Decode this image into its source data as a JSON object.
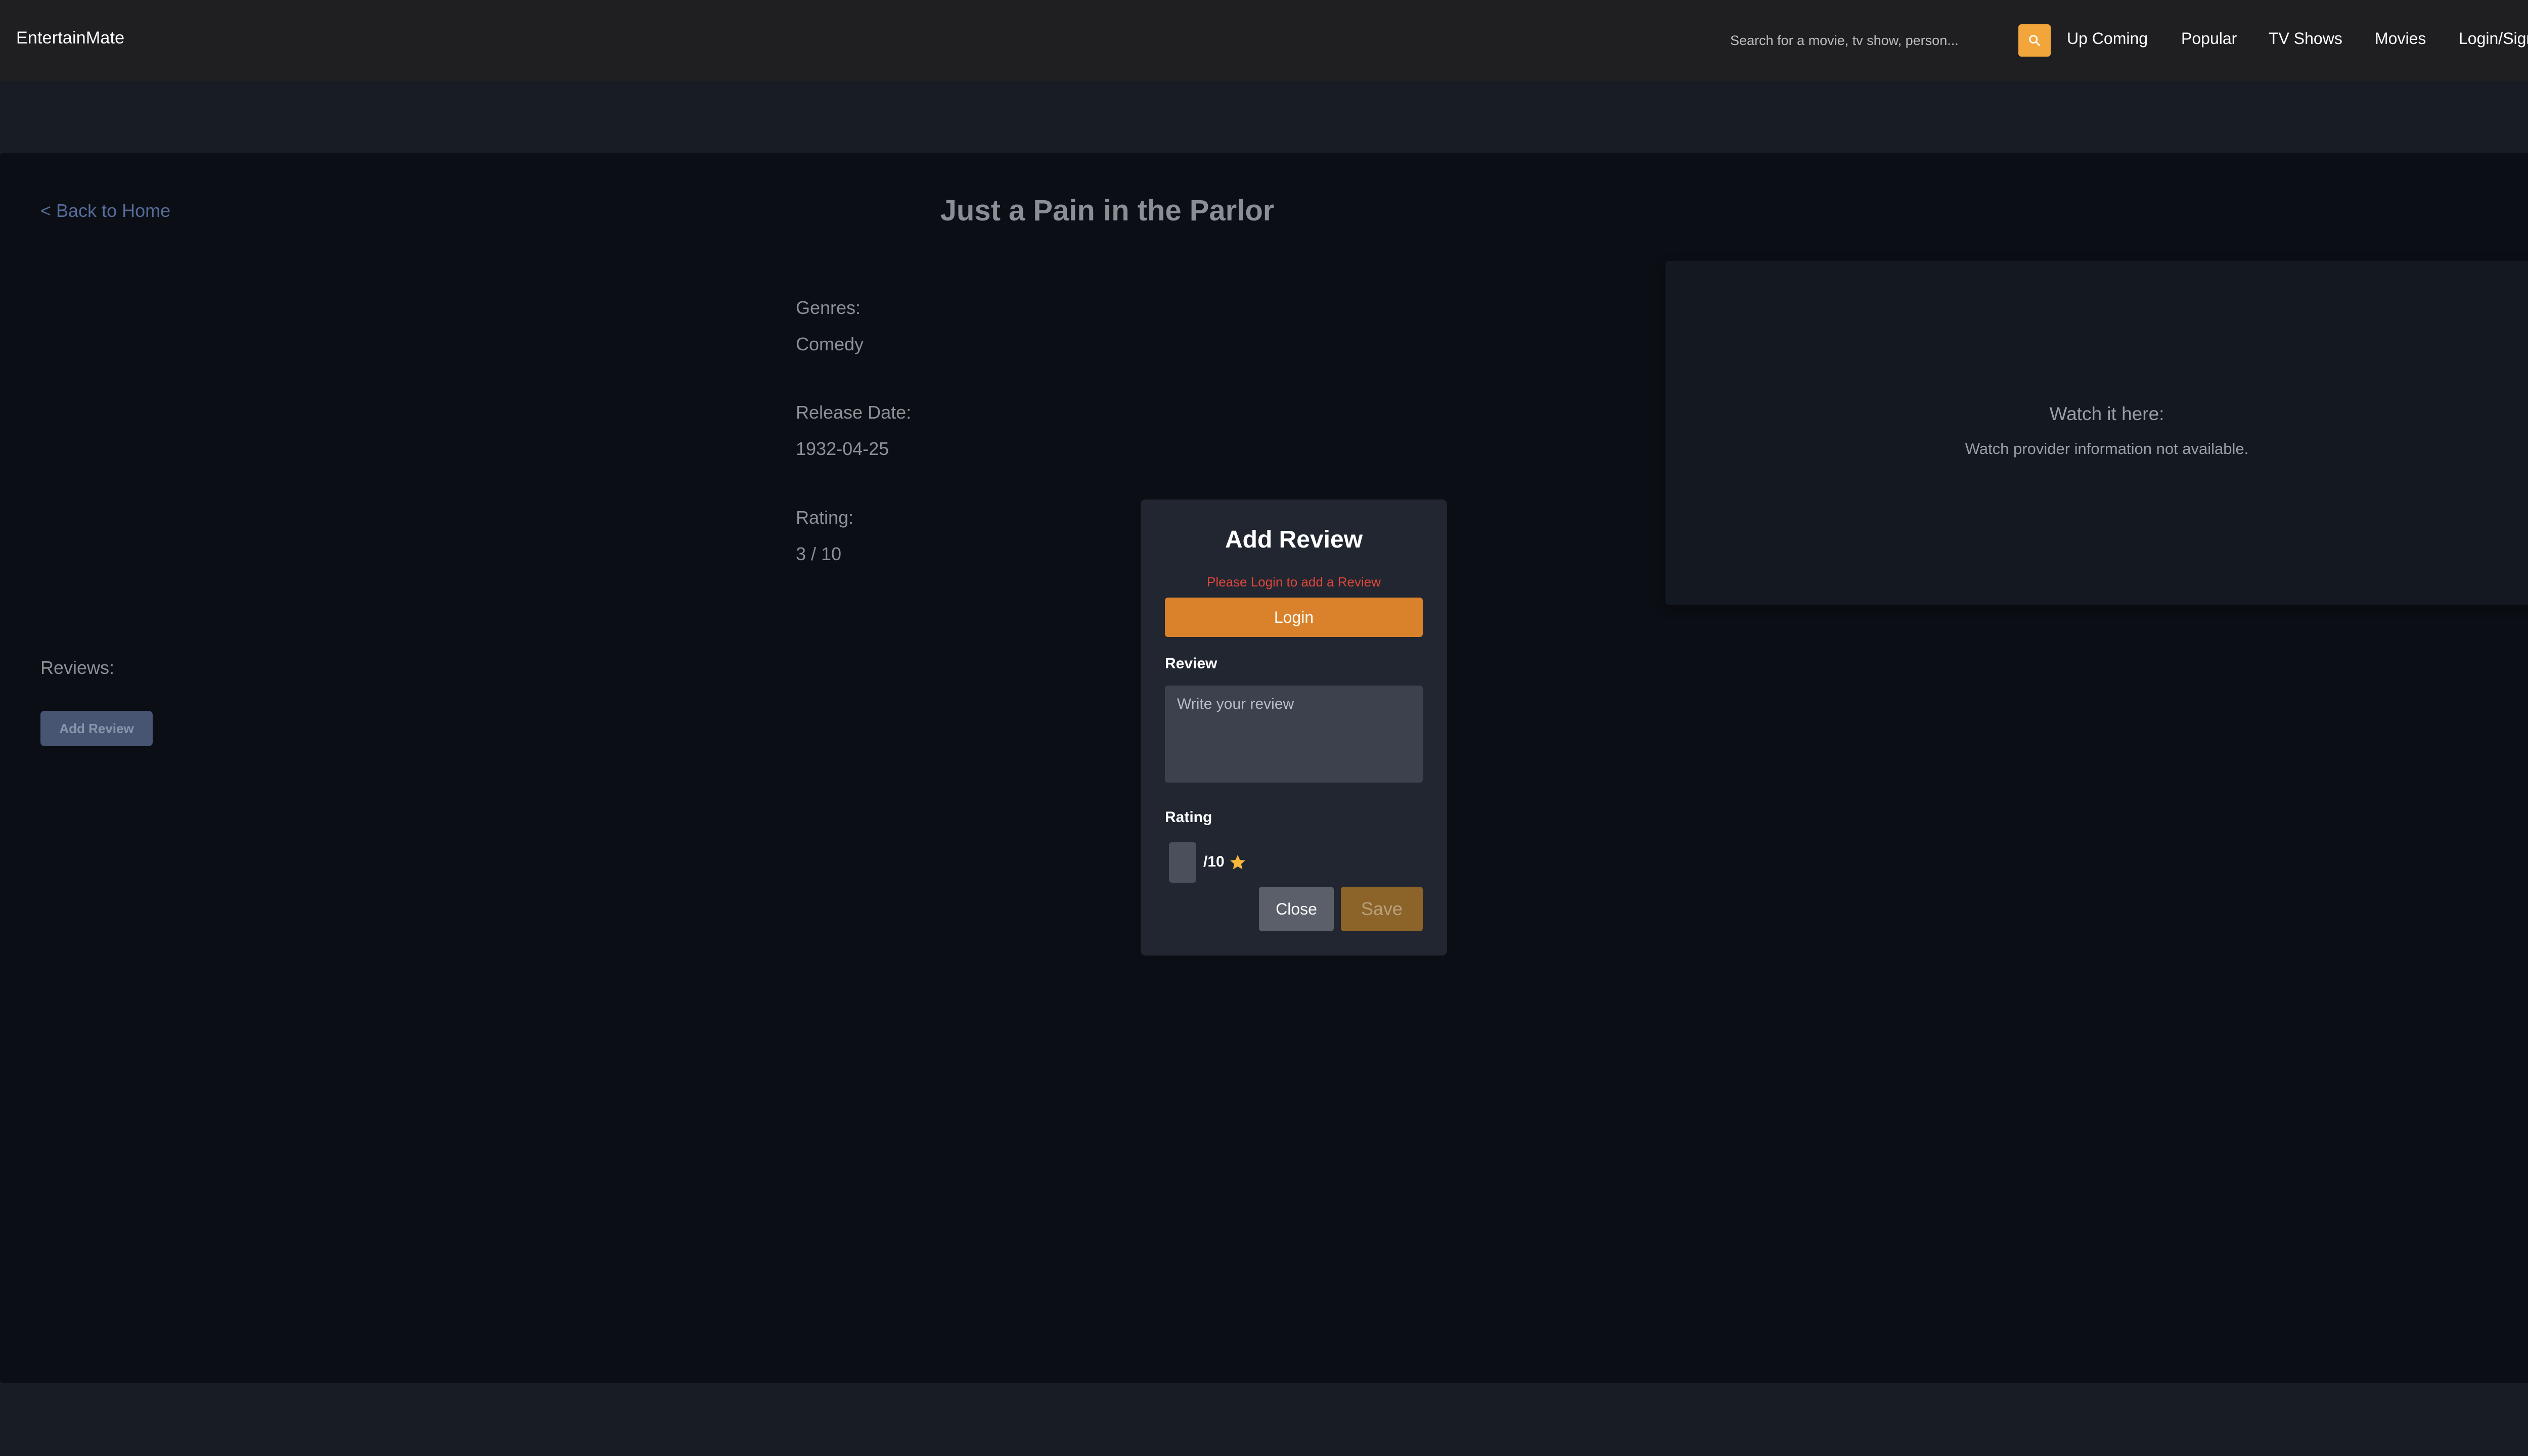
{
  "navbar": {
    "brand": "EntertainMate",
    "search_placeholder": "Search for a movie, tv show, person...",
    "search_icon": "search-icon",
    "links": [
      "Up Coming",
      "Popular",
      "TV Shows",
      "Movies",
      "Login/SignUp"
    ]
  },
  "page": {
    "back_link": "< Back to Home",
    "title": "Just a Pain in the Parlor",
    "genres_label": "Genres:",
    "genres_value": "Comedy",
    "release_label": "Release Date:",
    "release_value": "1932-04-25",
    "rating_label": "Rating:",
    "rating_value": "3 / 10",
    "reviews_label": "Reviews:",
    "add_review_button": "Add Review"
  },
  "watch": {
    "title": "Watch it here:",
    "message": "Watch provider information not available."
  },
  "modal": {
    "title": "Add Review",
    "error": "Please Login to add a Review",
    "login_button": "Login",
    "review_label": "Review",
    "review_placeholder": "Write your review",
    "rating_label": "Rating",
    "rating_value": "",
    "rating_suffix": "/10",
    "star_icon": "star-icon",
    "close_button": "Close",
    "save_button": "Save"
  },
  "colors": {
    "accent": "#f2a53a",
    "login_button": "#d9822b",
    "error_text": "#e0473a",
    "background": "#181c24",
    "card": "#0b0e14"
  }
}
